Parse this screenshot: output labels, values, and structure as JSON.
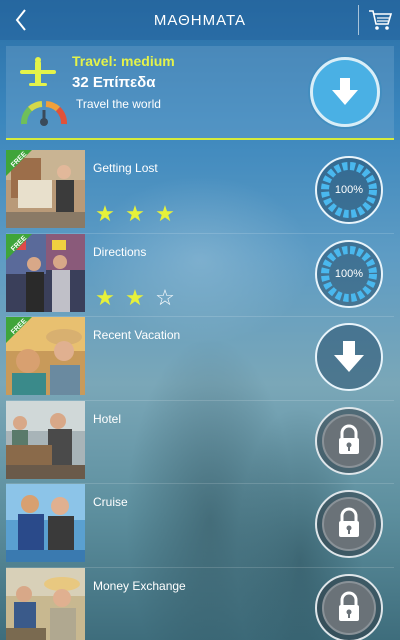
{
  "header": {
    "title": "ΜΑΘΗΜΑΤΑ",
    "back_icon": "chevron-left-icon",
    "cart_icon": "cart-icon"
  },
  "course": {
    "title": "Travel: medium",
    "levels": "32 Επίπεδα",
    "tagline": "Travel the world",
    "accent_color": "#e4f34a",
    "download_color": "#4ab0e4"
  },
  "badge": "FREE",
  "lessons": [
    {
      "title": "Getting Lost",
      "free": true,
      "stars": 3,
      "status": "progress",
      "progress_label": "100%",
      "progress": 1.0
    },
    {
      "title": "Directions",
      "free": true,
      "stars": 2,
      "status": "progress",
      "progress_label": "100%",
      "progress": 1.0
    },
    {
      "title": "Recent Vacation",
      "free": true,
      "stars": 0,
      "status": "download"
    },
    {
      "title": "Hotel",
      "free": false,
      "stars": 0,
      "status": "locked"
    },
    {
      "title": "Cruise",
      "free": false,
      "stars": 0,
      "status": "locked"
    },
    {
      "title": "Money Exchange",
      "free": false,
      "stars": 0,
      "status": "locked"
    }
  ]
}
